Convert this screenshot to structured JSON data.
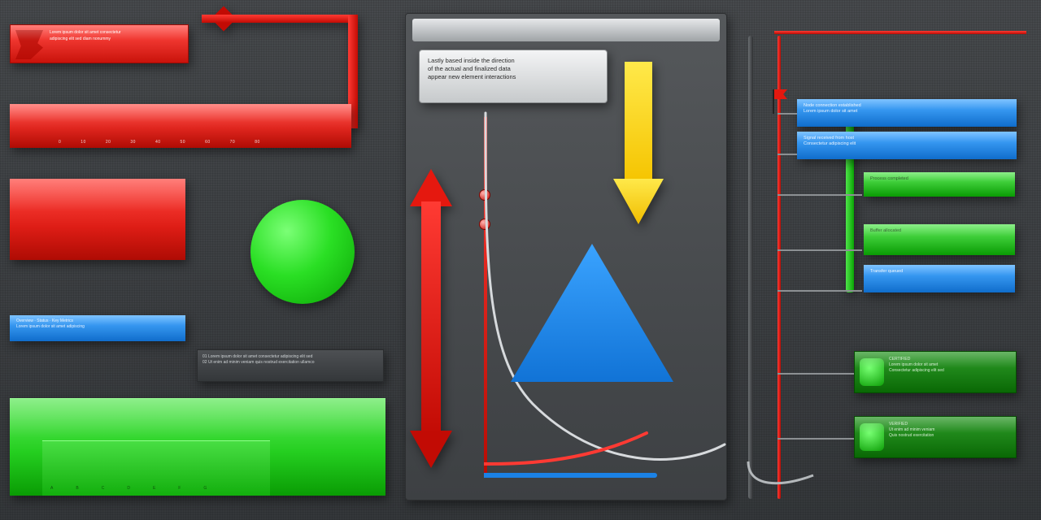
{
  "top_red_card": {
    "line1": "Lorem ipsum dolor sit amet consectetur",
    "line2": "adipiscing elit sed diam nonummy"
  },
  "red_hbar": {
    "ticks": [
      "0",
      "10",
      "20",
      "30",
      "40",
      "50",
      "60",
      "70",
      "80"
    ]
  },
  "blue_thin": {
    "line1": "Overview · Status · Key Metrics",
    "line2": "Lorem ipsum dolor sit amet adipiscing"
  },
  "dark_strip": {
    "l1": "01  Lorem ipsum dolor sit amet consectetur adipiscing elit sed",
    "l2": "02  Ut enim ad minim veniam quis nostrud exercitation ullamco"
  },
  "green_big": {
    "ticks": [
      "A",
      "B",
      "C",
      "D",
      "E",
      "F",
      "G"
    ]
  },
  "panel": {
    "callout_l1": "Lastly based inside the direction",
    "callout_l2": "of the actual and finalized data",
    "callout_l3": "appear new element interactions"
  },
  "right_items": [
    {
      "l1": "Node connection established",
      "l2": "Lorem ipsum dolor sit amet"
    },
    {
      "l1": "Signal received from host",
      "l2": "Consectetur adipiscing elit"
    },
    {
      "l1": "Process completed",
      "l2": ""
    },
    {
      "l1": "Buffer allocated",
      "l2": ""
    },
    {
      "l1": "Transfer queued",
      "l2": ""
    }
  ],
  "green_cards": [
    {
      "l1": "CERTIFIED",
      "l2": "Lorem ipsum dolor sit amet",
      "l3": "Consectetur adipiscing elit sed"
    },
    {
      "l1": "VERIFIED",
      "l2": "Ut enim ad minim veniam",
      "l3": "Quis nostrud exercitation"
    }
  ],
  "colors": {
    "red": "#e0150d",
    "green": "#1ccf17",
    "blue": "#1b82e6",
    "yellow": "#f5c400"
  }
}
